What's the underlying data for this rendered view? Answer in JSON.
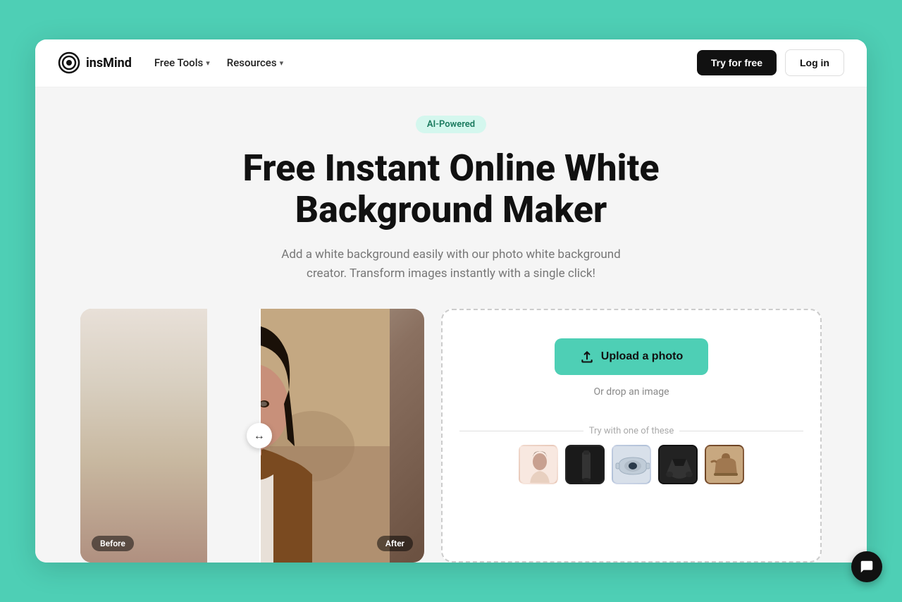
{
  "brand": {
    "name": "insMind",
    "logo_alt": "insMind logo"
  },
  "nav": {
    "links": [
      {
        "label": "Free Tools",
        "has_dropdown": true
      },
      {
        "label": "Resources",
        "has_dropdown": true
      }
    ],
    "cta_primary": "Try for free",
    "cta_secondary": "Log in"
  },
  "hero": {
    "badge": "AI-Powered",
    "title": "Free Instant Online White Background Maker",
    "subtitle": "Add a white background easily with our photo white background creator. Transform images instantly with a single click!"
  },
  "before_after": {
    "before_label": "Before",
    "after_label": "After"
  },
  "upload": {
    "button_label": "Upload a photo",
    "drop_text": "Or drop an image",
    "try_label": "Try with one of these",
    "samples": [
      {
        "id": 1,
        "alt": "sample person 1"
      },
      {
        "id": 2,
        "alt": "sample bottle"
      },
      {
        "id": 3,
        "alt": "sample headphones"
      },
      {
        "id": 4,
        "alt": "sample shoe"
      },
      {
        "id": 5,
        "alt": "sample bag"
      }
    ]
  },
  "chat": {
    "icon": "💬"
  }
}
